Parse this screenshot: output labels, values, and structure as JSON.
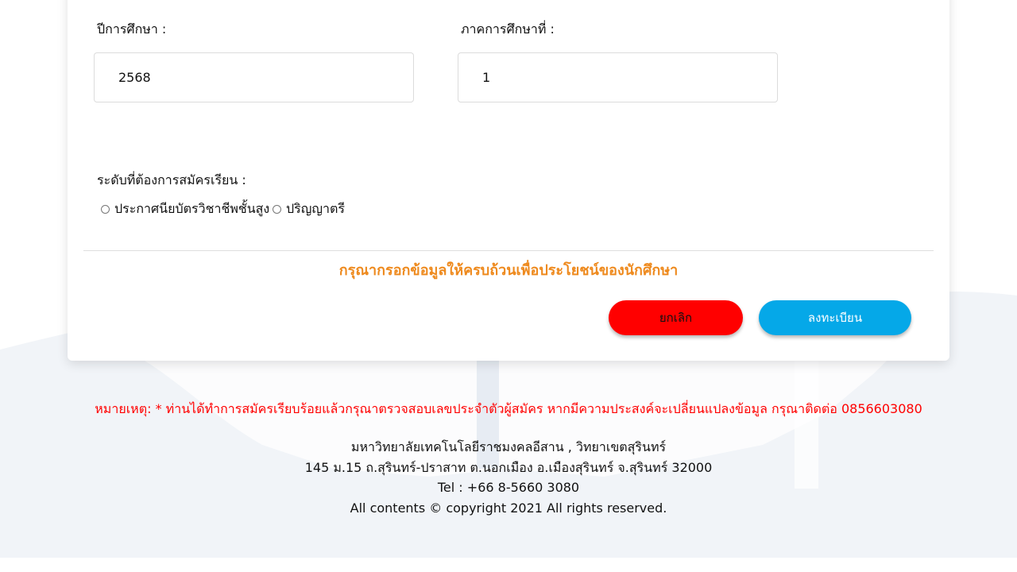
{
  "form": {
    "year_label": "ปีการศึกษา :",
    "year_value": "2568",
    "semester_label": "ภาคการศึกษาที่ :",
    "semester_value": "1",
    "level_label": "ระดับที่ต้องการสมัครเรียน :",
    "level_options": [
      "ประกาศนียบัตรวิชาชีพชั้นสูง",
      "ปริญญาตรี"
    ],
    "notice": "กรุณากรอกข้อมูลให้ครบถ้วนเพื่อประโยชน์ของนักศึกษา",
    "cancel_label": "ยกเลิก",
    "submit_label": "ลงทะเบียน"
  },
  "remark": "หมายเหตุ: * ท่านได้ทำการสมัครเรียบร้อยแล้วกรุณาตรวจสอบเลขประจำตัวผู้สมัคร หากมีความประสงค์จะเปลี่ยนแปลงข้อมูล กรุณาติดต่อ 0856603080",
  "footer": {
    "institution": "มหาวิทยาลัยเทคโนโลยีราชมงคลอีสาน , วิทยาเขตสุรินทร์",
    "address": "145 ม.15 ถ.สุรินทร์-ปราสาท ต.นอกเมือง อ.เมืองสุรินทร์ จ.สุรินทร์ 32000",
    "tel": "Tel : +66 8-5660 3080",
    "copyright": "All contents © copyright 2021 All rights reserved."
  },
  "colors": {
    "background_band": "#f1f4f8",
    "notice": "#ee8a1e",
    "cancel_button": "#ff0000",
    "submit_button": "#05a8e8",
    "remark": "#ff0000"
  }
}
